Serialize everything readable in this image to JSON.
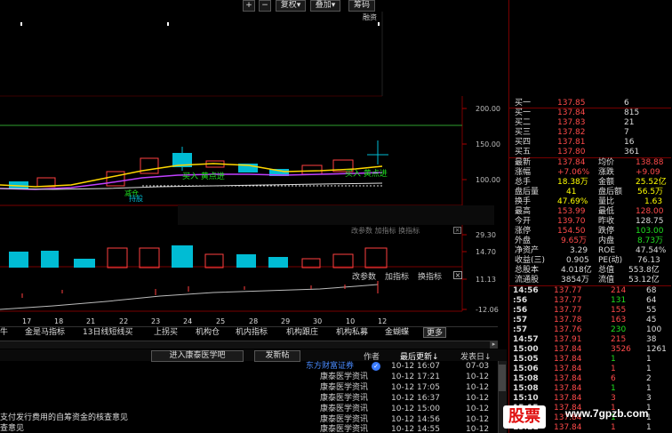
{
  "toolbar": {
    "plus": "+",
    "minus": "−",
    "restore": "复权",
    "overlay": "叠加",
    "chips": "筹码",
    "margin": "融资"
  },
  "price_axis": [
    "200.00",
    "150.00",
    "100.00"
  ],
  "indicator_axis": [
    "29.30",
    "14.70"
  ],
  "vol_axis": [
    "11.13",
    "-12.06"
  ],
  "signals": {
    "buy1": "买入 黄点进",
    "buy2": "买入 黄点进",
    "sell": "减仓",
    "hold": "持股"
  },
  "panel_labels": {
    "indicator_partial": "改参数 加指标 换指标",
    "modify_params": "改参数",
    "add_indicator": "加指标",
    "change_indicator": "换指标"
  },
  "dates": [
    "17",
    "18",
    "21",
    "22",
    "23",
    "24",
    "25",
    "28",
    "29",
    "30",
    "10",
    "12"
  ],
  "tabs": [
    "牛",
    "金是马指标",
    "13日线短线买",
    "上拐买",
    "机构仓",
    "机内指标",
    "机构跟庄",
    "机构私募",
    "金蝴蝶",
    "更多"
  ],
  "news_bar": {
    "enter_btn": "进入康泰医学吧",
    "post_btn": "发新帖",
    "author_col": "作者",
    "latest_col": "最后更新",
    "post_col": "发表日"
  },
  "news": [
    {
      "author": "东方财富证券",
      "updated": "10-12 16:07",
      "posted": "07-03"
    },
    {
      "author": "康泰医学资讯",
      "updated": "10-12 17:21",
      "posted": "10-12"
    },
    {
      "author": "康泰医学资讯",
      "updated": "10-12 17:05",
      "posted": "10-12"
    },
    {
      "author": "康泰医学资讯",
      "updated": "10-12 16:37",
      "posted": "10-12"
    },
    {
      "author": "康泰医学资讯",
      "updated": "10-12 15:00",
      "posted": "10-12"
    },
    {
      "author": "康泰医学资讯",
      "updated": "10-12 14:56",
      "posted": "10-12"
    },
    {
      "author": "康泰医学资讯",
      "updated": "10-12 14:55",
      "posted": "10-12"
    }
  ],
  "news_titles": [
    "支付发行费用的自筹资金的核查意见",
    "查意见"
  ],
  "order_book": [
    {
      "label": "买一",
      "price": "137.84",
      "vol": "815"
    },
    {
      "label": "买二",
      "price": "137.83",
      "vol": "21"
    },
    {
      "label": "买三",
      "price": "137.82",
      "vol": "7"
    },
    {
      "label": "买四",
      "price": "137.81",
      "vol": "16"
    },
    {
      "label": "买五",
      "price": "137.80",
      "vol": "361"
    }
  ],
  "order_top": {
    "label": "买一",
    "price": "137.85",
    "vol": "6"
  },
  "quote": [
    {
      "l1": "最新",
      "v1": "137.84",
      "l2": "均价",
      "v2": "138.88"
    },
    {
      "l1": "涨幅",
      "v1": "+7.06%",
      "l2": "涨跌",
      "v2": "+9.09"
    },
    {
      "l1": "总手",
      "v1": "18.38万",
      "l2": "金额",
      "v2": "25.52亿"
    },
    {
      "l1": "盘后量",
      "v1": "41",
      "l2": "盘后额",
      "v2": "56.5万"
    },
    {
      "l1": "换手",
      "v1": "47.69%",
      "l2": "量比",
      "v2": "1.63"
    },
    {
      "l1": "最高",
      "v1": "153.99",
      "l2": "最低",
      "v2": "128.00"
    },
    {
      "l1": "今开",
      "v1": "139.70",
      "l2": "昨收",
      "v2": "128.75"
    },
    {
      "l1": "涨停",
      "v1": "154.50",
      "l2": "跌停",
      "v2": "103.00"
    },
    {
      "l1": "外盘",
      "v1": "9.65万",
      "l2": "内盘",
      "v2": "8.73万"
    },
    {
      "l1": "净资产",
      "v1": "3.29",
      "l2": "ROE",
      "v2": "47.54%"
    },
    {
      "l1": "收益(三)",
      "v1": "0.905",
      "l2": "PE(动)",
      "v2": "76.13"
    },
    {
      "l1": "总股本",
      "v1": "4.018亿",
      "l2": "总值",
      "v2": "553.8亿"
    },
    {
      "l1": "流通股",
      "v1": "3854万",
      "l2": "流值",
      "v2": "53.12亿"
    }
  ],
  "ticks": [
    {
      "t": "14:56",
      "p": "137.77",
      "v": "214",
      "n": "68"
    },
    {
      "t": ":56",
      "p": "137.77",
      "v": "131",
      "n": "64"
    },
    {
      "t": ":56",
      "p": "137.77",
      "v": "155",
      "n": "55"
    },
    {
      "t": ":57",
      "p": "137.78",
      "v": "163",
      "n": "45"
    },
    {
      "t": ":57",
      "p": "137.76",
      "v": "230",
      "n": "100"
    },
    {
      "t": "14:57",
      "p": "137.91",
      "v": "215",
      "n": "38"
    },
    {
      "t": "15:00",
      "p": "137.84",
      "v": "3526",
      "n": "1261"
    },
    {
      "t": "15:05",
      "p": "137.84",
      "v": "1",
      "n": "1"
    },
    {
      "t": "15:06",
      "p": "137.84",
      "v": "1",
      "n": "1"
    },
    {
      "t": "15:08",
      "p": "137.84",
      "v": "6",
      "n": "2"
    },
    {
      "t": "15:08",
      "p": "137.84",
      "v": "1",
      "n": "1"
    },
    {
      "t": "15:10",
      "p": "137.84",
      "v": "3",
      "n": "3"
    },
    {
      "t": "15:15",
      "p": "137.84",
      "v": "1",
      "n": "1"
    },
    {
      "t": "15:19",
      "p": "137.84",
      "v": "1",
      "n": "1"
    },
    {
      "t": "15:21",
      "p": "137.84",
      "v": "1",
      "n": "1"
    }
  ],
  "watermark": {
    "logo": "股票",
    "url": "www.7gpzb.com"
  }
}
